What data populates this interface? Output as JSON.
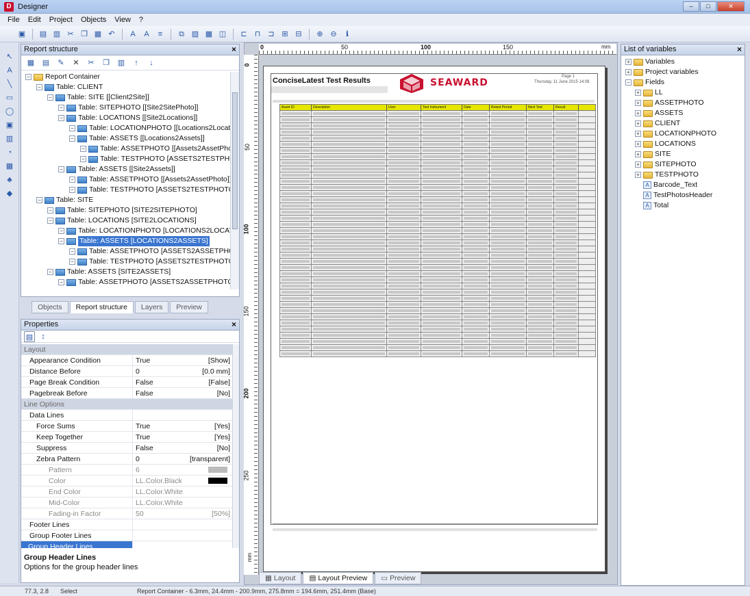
{
  "window": {
    "title": "Designer"
  },
  "menu": [
    "File",
    "Edit",
    "Project",
    "Objects",
    "View",
    "?"
  ],
  "report_structure": {
    "title": "Report structure",
    "items": [
      {
        "label": "Report Container",
        "indent": 0,
        "icon": "folder"
      },
      {
        "label": "Table: CLIENT",
        "indent": 1,
        "icon": "table"
      },
      {
        "label": "Table: SITE [[Client2Site]]",
        "indent": 2,
        "icon": "table"
      },
      {
        "label": "Table: SITEPHOTO [[Site2SitePhoto]]",
        "indent": 3,
        "icon": "table"
      },
      {
        "label": "Table: LOCATIONS [[Site2Locations]]",
        "indent": 3,
        "icon": "table"
      },
      {
        "label": "Table: LOCATIONPHOTO [[Locations2Locati",
        "indent": 4,
        "icon": "table"
      },
      {
        "label": "Table: ASSETS [[Locations2Assets]]",
        "indent": 4,
        "icon": "table"
      },
      {
        "label": "Table: ASSETPHOTO [[Assets2AssetPhoto",
        "indent": 5,
        "icon": "table"
      },
      {
        "label": "Table: TESTPHOTO [ASSETS2TESTPHOTC",
        "indent": 5,
        "icon": "table"
      },
      {
        "label": "Table: ASSETS [[Site2Assets]]",
        "indent": 3,
        "icon": "table"
      },
      {
        "label": "Table: ASSETPHOTO [[Assets2AssetPhoto]]",
        "indent": 4,
        "icon": "table"
      },
      {
        "label": "Table: TESTPHOTO [ASSETS2TESTPHOTO]",
        "indent": 4,
        "icon": "table"
      },
      {
        "label": "Table: SITE",
        "indent": 1,
        "icon": "table"
      },
      {
        "label": "Table: SITEPHOTO [SITE2SITEPHOTO]",
        "indent": 2,
        "icon": "table"
      },
      {
        "label": "Table: LOCATIONS [SITE2LOCATIONS]",
        "indent": 2,
        "icon": "table"
      },
      {
        "label": "Table: LOCATIONPHOTO [LOCATIONS2LOCATI",
        "indent": 3,
        "icon": "table"
      },
      {
        "label": "Table: ASSETS [LOCATIONS2ASSETS]",
        "indent": 3,
        "icon": "table",
        "selected": true
      },
      {
        "label": "Table: ASSETPHOTO [ASSETS2ASSETPHOTO",
        "indent": 4,
        "icon": "table"
      },
      {
        "label": "Table: TESTPHOTO [ASSETS2TESTPHOTO]",
        "indent": 4,
        "icon": "table"
      },
      {
        "label": "Table: ASSETS [SITE2ASSETS]",
        "indent": 2,
        "icon": "table"
      },
      {
        "label": "Table: ASSETPHOTO [ASSETS2ASSETPHOTO]",
        "indent": 3,
        "icon": "table"
      }
    ]
  },
  "left_tabs": [
    "Objects",
    "Report structure",
    "Layers",
    "Preview"
  ],
  "properties": {
    "title": "Properties",
    "rows": [
      {
        "name": "Layout",
        "type": "cat"
      },
      {
        "name": "Appearance Condition",
        "value": "True",
        "display": "[Show]"
      },
      {
        "name": "Distance Before",
        "value": "0",
        "display": "[0.0 mm]"
      },
      {
        "name": "Page Break Condition",
        "value": "False",
        "display": "[False]"
      },
      {
        "name": "Pagebreak Before",
        "value": "False",
        "display": "[No]"
      },
      {
        "name": "Line Options",
        "type": "cat"
      },
      {
        "name": "Data Lines",
        "type": "group"
      },
      {
        "name": "Force Sums",
        "value": "True",
        "display": "[Yes]"
      },
      {
        "name": "Keep Together",
        "value": "True",
        "display": "[Yes]"
      },
      {
        "name": "Suppress",
        "value": "False",
        "display": "[No]"
      },
      {
        "name": "Zebra Pattern",
        "value": "0",
        "display": "[transparent]"
      },
      {
        "name": "Pattern",
        "value": "6",
        "display": "",
        "type": "dim"
      },
      {
        "name": "Color",
        "value": "LL.Color.Black",
        "display": "",
        "type": "dim"
      },
      {
        "name": "End Color",
        "value": "LL.Color.White",
        "display": "",
        "type": "dim"
      },
      {
        "name": "Mid-Color",
        "value": "LL.Color.White",
        "display": "",
        "type": "dim"
      },
      {
        "name": "Fading-in Factor",
        "value": "50",
        "display": "[50%]",
        "type": "dim"
      },
      {
        "name": "Footer Lines",
        "type": "group"
      },
      {
        "name": "Group Footer Lines",
        "type": "group"
      },
      {
        "name": "Group Header Lines",
        "type": "sel"
      }
    ],
    "help_title": "Group Header Lines",
    "help_text": "Options for the group header lines"
  },
  "canvas": {
    "ruler_marks": [
      "0",
      "50",
      "100",
      "150",
      "mm"
    ],
    "vruler_marks": [
      "0",
      "50",
      "100",
      "150",
      "200",
      "250",
      "mm"
    ],
    "report_title": "ConciseLatest Test Results",
    "brand": "SEAWARD",
    "page_label": "Page 1",
    "date_text": "Thursday, 11 June 2015 14:08",
    "columns": [
      "Asset ID",
      "Description",
      "User",
      "Test Instrument",
      "Date",
      "Retest Period",
      "Next Test",
      "Result"
    ],
    "row_count": 40,
    "tabs": [
      "Layout",
      "Layout Preview",
      "Preview"
    ]
  },
  "variables": {
    "title": "List of variables",
    "items": [
      {
        "label": "Variables",
        "indent": 0,
        "icon": "folder"
      },
      {
        "label": "Project variables",
        "indent": 0,
        "icon": "folder"
      },
      {
        "label": "Fields",
        "indent": 0,
        "icon": "folder"
      },
      {
        "label": "LL",
        "indent": 1,
        "icon": "folder"
      },
      {
        "label": "ASSETPHOTO",
        "indent": 1,
        "icon": "folder"
      },
      {
        "label": "ASSETS",
        "indent": 1,
        "icon": "folder"
      },
      {
        "label": "CLIENT",
        "indent": 1,
        "icon": "folder"
      },
      {
        "label": "LOCATIONPHOTO",
        "indent": 1,
        "icon": "folder"
      },
      {
        "label": "LOCATIONS",
        "indent": 1,
        "icon": "folder"
      },
      {
        "label": "SITE",
        "indent": 1,
        "icon": "folder"
      },
      {
        "label": "SITEPHOTO",
        "indent": 1,
        "icon": "folder"
      },
      {
        "label": "TESTPHOTO",
        "indent": 1,
        "icon": "folder"
      },
      {
        "label": "Barcode_Text",
        "indent": 1,
        "icon": "var"
      },
      {
        "label": "TestPhotosHeader",
        "indent": 1,
        "icon": "var"
      },
      {
        "label": "Total",
        "indent": 1,
        "icon": "var"
      }
    ]
  },
  "status": {
    "coords": "77.3, 2.8",
    "mode": "Select",
    "info": "Report Container - 6.3mm, 24.4mm - 200.9mm, 275.8mm = 194.6mm, 251.4mm (Base)"
  }
}
